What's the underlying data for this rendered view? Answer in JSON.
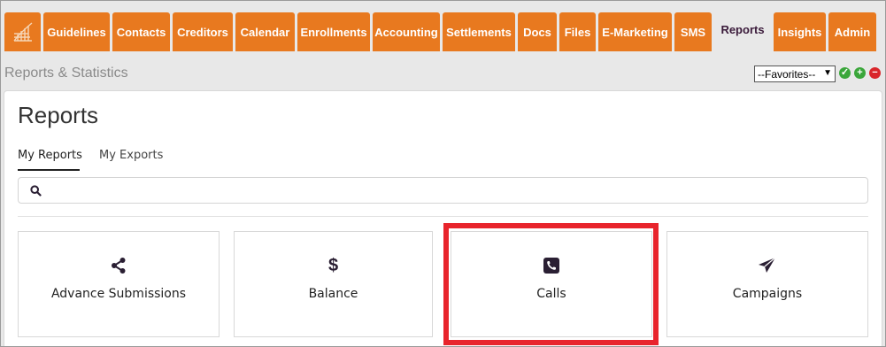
{
  "nav": {
    "tabs": [
      {
        "label": "Guidelines",
        "name": "guidelines"
      },
      {
        "label": "Contacts",
        "name": "contacts"
      },
      {
        "label": "Creditors",
        "name": "creditors"
      },
      {
        "label": "Calendar",
        "name": "calendar"
      },
      {
        "label": "Enrollments",
        "name": "enrollments"
      },
      {
        "label": "Accounting",
        "name": "accounting"
      },
      {
        "label": "Settlements",
        "name": "settlements"
      },
      {
        "label": "Docs",
        "name": "docs"
      },
      {
        "label": "Files",
        "name": "files"
      },
      {
        "label": "E-Marketing",
        "name": "e-marketing"
      },
      {
        "label": "SMS",
        "name": "sms"
      },
      {
        "label": "Reports",
        "name": "reports",
        "active": true
      },
      {
        "label": "Insights",
        "name": "insights"
      },
      {
        "label": "Admin",
        "name": "admin"
      }
    ],
    "logo_icon": "chart-logo-icon"
  },
  "header": {
    "title": "Reports & Statistics",
    "favorites_value": "--Favorites--",
    "actions": [
      {
        "name": "confirm-icon",
        "glyph": "✓",
        "color": "#3aa63a"
      },
      {
        "name": "add-icon",
        "glyph": "+",
        "color": "#3aa63a"
      },
      {
        "name": "remove-icon",
        "glyph": "−",
        "color": "#d9262b"
      }
    ]
  },
  "panel": {
    "heading": "Reports",
    "tabs": [
      {
        "label": "My Reports",
        "active": true
      },
      {
        "label": "My Exports",
        "active": false
      }
    ],
    "search_icon": "search-icon",
    "cards": [
      {
        "label": "Advance Submissions",
        "icon": "share-icon"
      },
      {
        "label": "Balance",
        "icon": "dollar-icon"
      },
      {
        "label": "Calls",
        "icon": "phone-icon",
        "highlighted": true
      },
      {
        "label": "Campaigns",
        "icon": "paper-plane-icon"
      }
    ]
  },
  "colors": {
    "nav_tab": "#e8791f",
    "active_tab_text": "#3a1a3a",
    "highlight": "#e8242c",
    "icon": "#2a1f33"
  }
}
